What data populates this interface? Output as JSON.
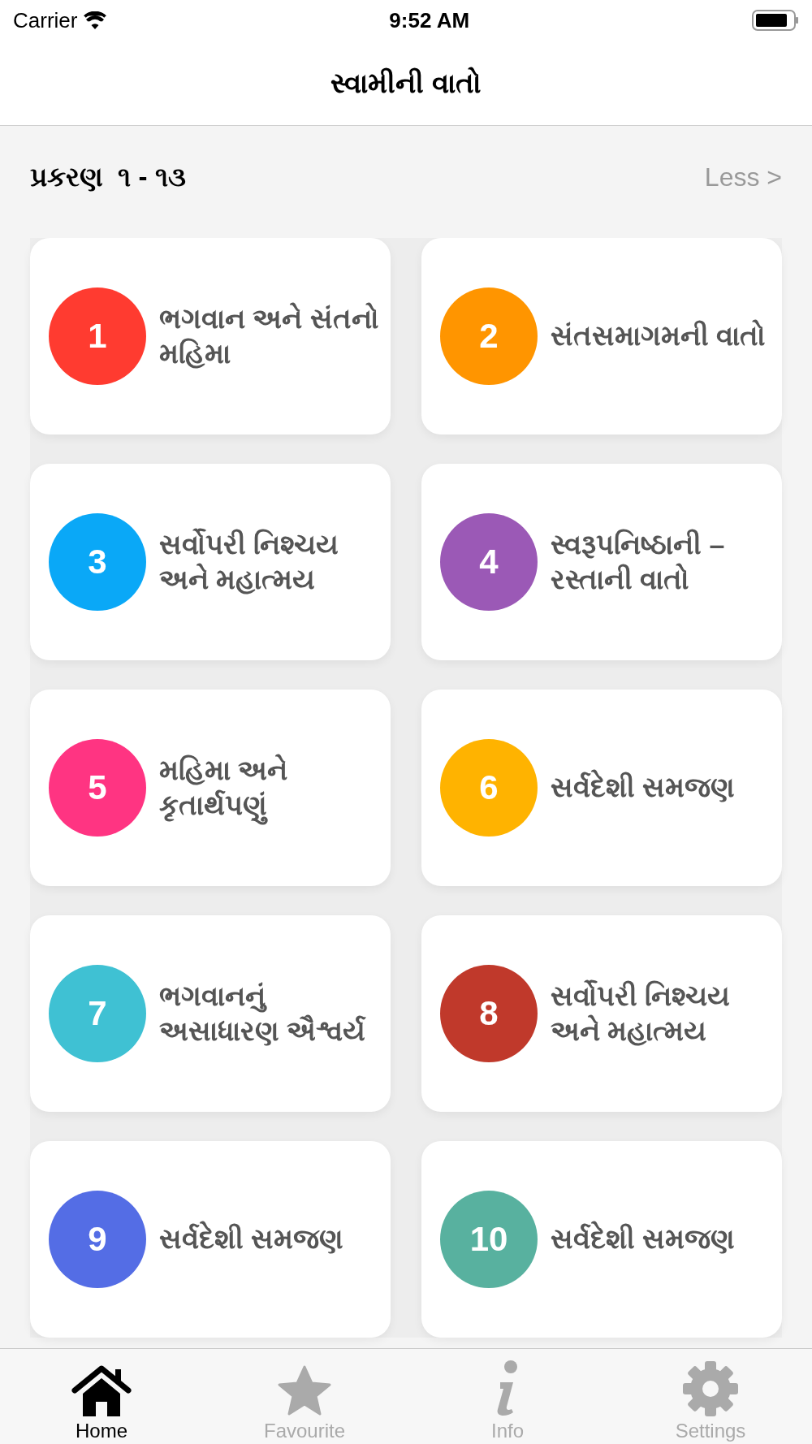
{
  "status_bar": {
    "carrier": "Carrier",
    "time": "9:52 AM"
  },
  "nav": {
    "title": "સ્વામીની વાતો"
  },
  "section": {
    "title": "પ્રકરણ  ૧ - ૧૩",
    "toggle": "Less >"
  },
  "chapters": [
    {
      "number": "1",
      "title": "ભગવાન અને સંતનો મહિમા",
      "color": "#ff3b30"
    },
    {
      "number": "2",
      "title": "સંતસમાગમની વાતો",
      "color": "#ff9500"
    },
    {
      "number": "3",
      "title": "સર્વોપરી નિશ્ચય અને મહાત્મય",
      "color": "#0aa8f7"
    },
    {
      "number": "4",
      "title": "સ્વરૂપનિષ્ઠાની – રસ્તાની વાતો",
      "color": "#9b59b6"
    },
    {
      "number": "5",
      "title": "મહિમા અને કૃતાર્થપણું",
      "color": "#ff3482"
    },
    {
      "number": "6",
      "title": "સર્વદેશી સમજણ",
      "color": "#ffb300"
    },
    {
      "number": "7",
      "title": "ભગવાનનું અસાધારણ ઐશ્વર્ય",
      "color": "#3fc1d3"
    },
    {
      "number": "8",
      "title": "સર્વોપરી નિશ્ચય અને મહાત્મય",
      "color": "#c0392b"
    },
    {
      "number": "9",
      "title": "સર્વદેશી સમજણ",
      "color": "#546de5"
    },
    {
      "number": "10",
      "title": "સર્વદેશી સમજણ",
      "color": "#58b19f"
    }
  ],
  "tabs": [
    {
      "label": "Home",
      "kind": "home",
      "selected": true
    },
    {
      "label": "Favourite",
      "kind": "star",
      "selected": false
    },
    {
      "label": "Info",
      "kind": "info",
      "selected": false
    },
    {
      "label": "Settings",
      "kind": "gear",
      "selected": false
    }
  ]
}
